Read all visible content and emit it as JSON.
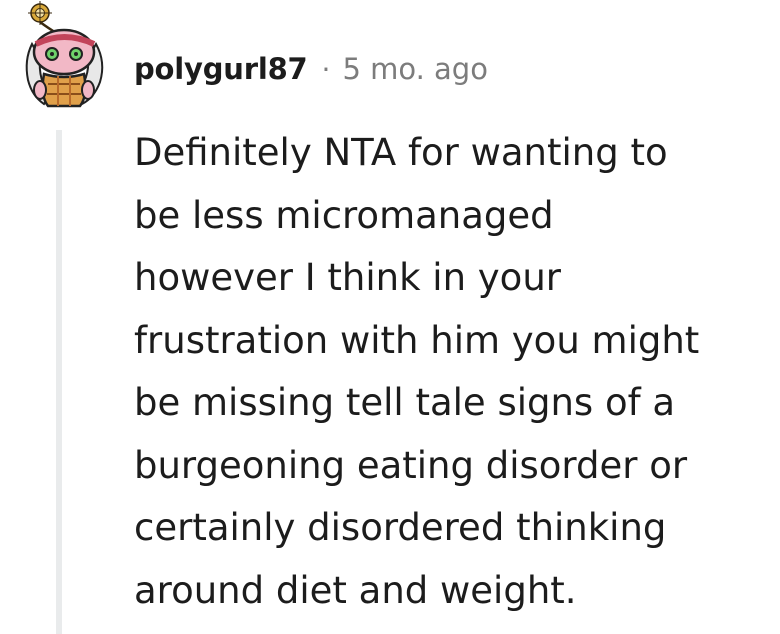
{
  "comment": {
    "username": "polygurl87",
    "separator": "·",
    "age": "5 mo. ago",
    "avatar_icon": "snoo-avatar-icon",
    "body_lines": [
      "Definitely NTA for wanting to",
      "be less micromanaged",
      "however I think in your",
      "frustration with him you might",
      "be missing tell tale signs of a",
      "burgeoning eating disorder or",
      "certainly disordered thinking",
      "around diet and weight."
    ]
  },
  "colors": {
    "text": "#1c1c1c",
    "meta": "#7c7c7c",
    "thread_line": "#e9ebec"
  }
}
